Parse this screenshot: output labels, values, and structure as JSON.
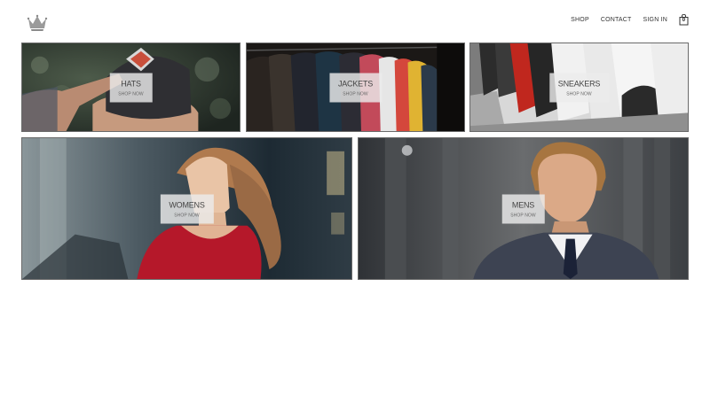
{
  "header": {
    "logo_icon": "crown-icon",
    "nav": [
      {
        "label": "SHOP"
      },
      {
        "label": "CONTACT"
      },
      {
        "label": "SIGN IN"
      }
    ],
    "cart": {
      "icon": "shopping-bag-icon",
      "count": "0"
    }
  },
  "categories": {
    "hats": {
      "title": "HATS",
      "cta": "SHOP NOW"
    },
    "jackets": {
      "title": "JACKETS",
      "cta": "SHOP NOW"
    },
    "sneakers": {
      "title": "SNEAKERS",
      "cta": "SHOP NOW"
    },
    "womens": {
      "title": "WOMENS",
      "cta": "SHOP NOW"
    },
    "mens": {
      "title": "MENS",
      "cta": "SHOP NOW"
    }
  }
}
